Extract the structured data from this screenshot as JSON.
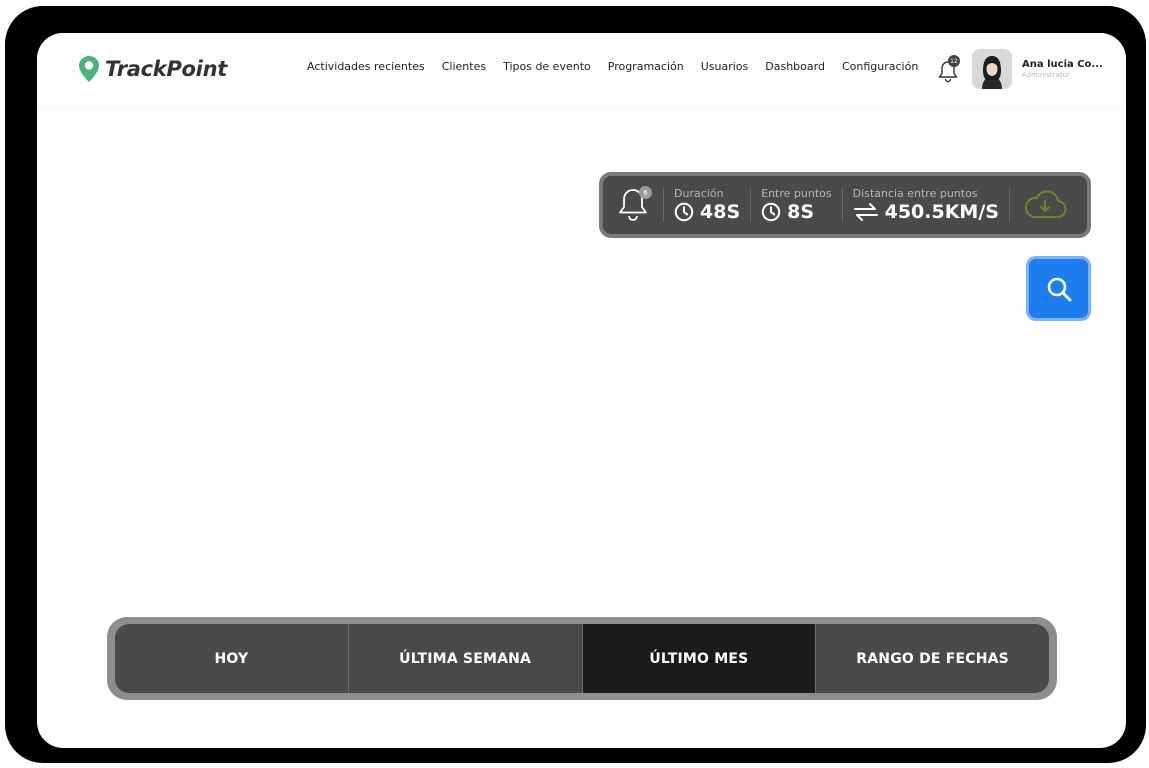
{
  "brand": {
    "name": "TrackPoint",
    "accent": "#4cb27a"
  },
  "nav": {
    "items": [
      {
        "label": "Actividades recientes"
      },
      {
        "label": "Clientes"
      },
      {
        "label": "Tipos de evento"
      },
      {
        "label": "Programación"
      },
      {
        "label": "Usuarios"
      },
      {
        "label": "Dashboard"
      },
      {
        "label": "Configuración"
      }
    ]
  },
  "notifications": {
    "count": "12",
    "icon": "bell-icon"
  },
  "user": {
    "name": "Ana lucia Co...",
    "role": "Administrator"
  },
  "stats": {
    "alerts_count": "6",
    "duration": {
      "label": "Duración",
      "value": "48S"
    },
    "between_points": {
      "label": "Entre puntos",
      "value": "8S"
    },
    "distance": {
      "label": "Distancia entre puntos",
      "value": "450.5KM/S"
    },
    "cloud_color": "#6a8a2a"
  },
  "search": {
    "icon": "search-icon",
    "color": "#1e7ef0"
  },
  "ranges": {
    "items": [
      {
        "label": "HOY"
      },
      {
        "label": "ÚLTIMA SEMANA"
      },
      {
        "label": "ÚLTIMO MES"
      },
      {
        "label": "RANGO DE FECHAS"
      }
    ],
    "active": "ÚLTIMO MES"
  }
}
